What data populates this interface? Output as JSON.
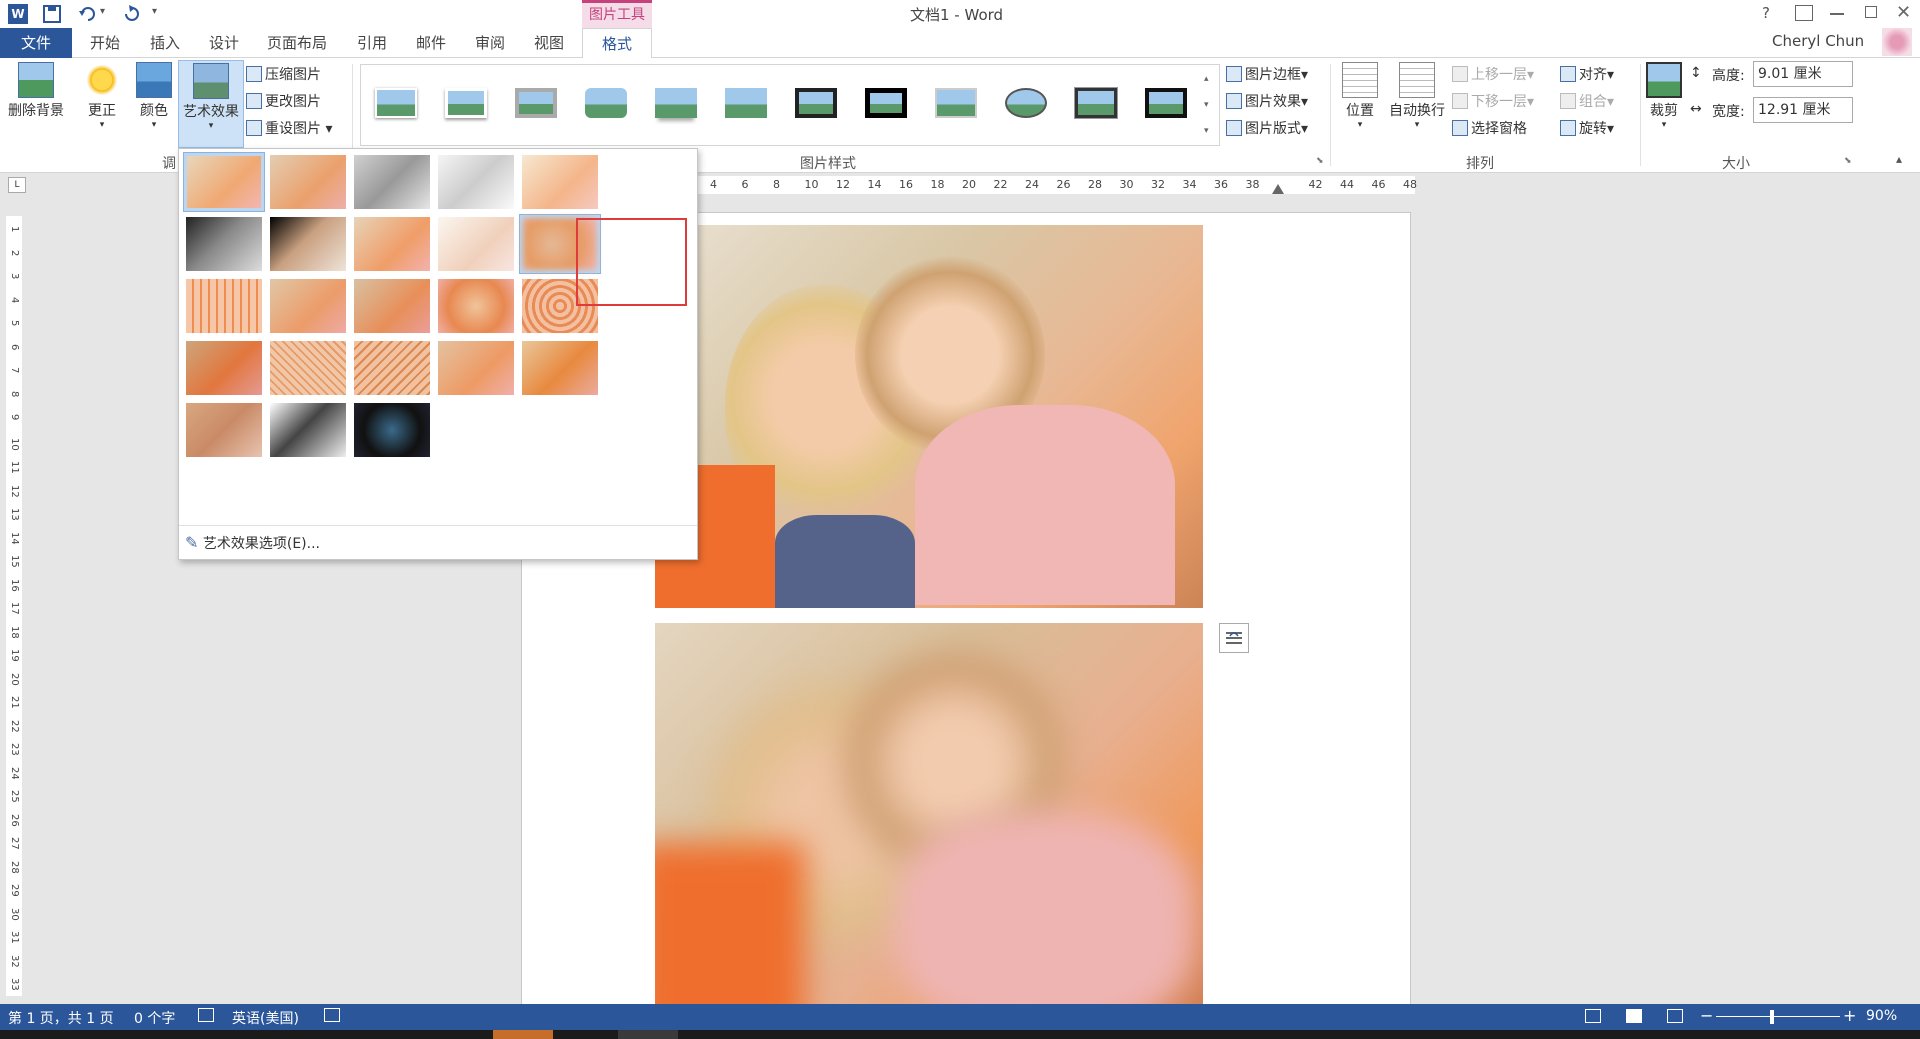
{
  "titlebar": {
    "doc_title": "文档1 - Word",
    "contextual_group": "图片工具",
    "help": "?",
    "user": "Cheryl Chun"
  },
  "tabs": {
    "file": "文件",
    "items": [
      "开始",
      "插入",
      "设计",
      "页面布局",
      "引用",
      "邮件",
      "审阅",
      "视图"
    ],
    "active": "格式"
  },
  "ribbon": {
    "adjust": {
      "remove_bg": "删除背景",
      "corrections": "更正",
      "color": "颜色",
      "artistic": "艺术效果",
      "compress": "压缩图片",
      "change": "更改图片",
      "reset": "重设图片",
      "label": "调"
    },
    "styles": {
      "label": "图片样式",
      "border": "图片边框",
      "effects": "图片效果",
      "layout": "图片版式"
    },
    "arrange": {
      "label": "排列",
      "position": "位置",
      "wrap": "自动换行",
      "forward": "上移一层",
      "backward": "下移一层",
      "selection_pane": "选择窗格",
      "align": "对齐",
      "group": "组合",
      "rotate": "旋转"
    },
    "size": {
      "label": "大小",
      "crop": "裁剪",
      "height_label": "高度:",
      "height_value": "9.01 厘米",
      "width_label": "宽度:",
      "width_value": "12.91 厘米"
    }
  },
  "gallery": {
    "options": "艺术效果选项(E)...",
    "effects": [
      "none",
      "marker",
      "pencil-grayscale",
      "pencil-sketch",
      "line-drawing",
      "chalk-sketch",
      "paint-strokes",
      "paint-brush",
      "glow-diffused",
      "blur",
      "light-screen",
      "watercolor-sponge",
      "film-grain",
      "mosaic-bubbles",
      "glass",
      "cement",
      "texturizer",
      "crisscross-etching",
      "pastels-smooth",
      "plastic-wrap",
      "cutout",
      "photocopy",
      "glow-edges"
    ],
    "selected_index": 9
  },
  "ruler": {
    "h_ticks": [
      "4",
      "6",
      "8",
      "10",
      "12",
      "14",
      "16",
      "18",
      "20",
      "22",
      "24",
      "26",
      "28",
      "30",
      "32",
      "34",
      "36",
      "38",
      "42",
      "44",
      "46",
      "48"
    ],
    "v_ticks": [
      "1",
      "2",
      "3",
      "4",
      "5",
      "6",
      "7",
      "8",
      "9",
      "10",
      "11",
      "12",
      "13",
      "14",
      "15",
      "16",
      "17",
      "18",
      "19",
      "20",
      "21",
      "22",
      "23",
      "24",
      "25",
      "26",
      "27",
      "28",
      "29",
      "30",
      "31",
      "32",
      "33"
    ]
  },
  "status": {
    "page": "第 1 页，共 1 页",
    "words": "0 个字",
    "language": "英语(美国)",
    "zoom": "90%"
  },
  "colors": {
    "accent": "#2b579a",
    "context": "#c5427c",
    "highlight": "#e03b3b"
  }
}
